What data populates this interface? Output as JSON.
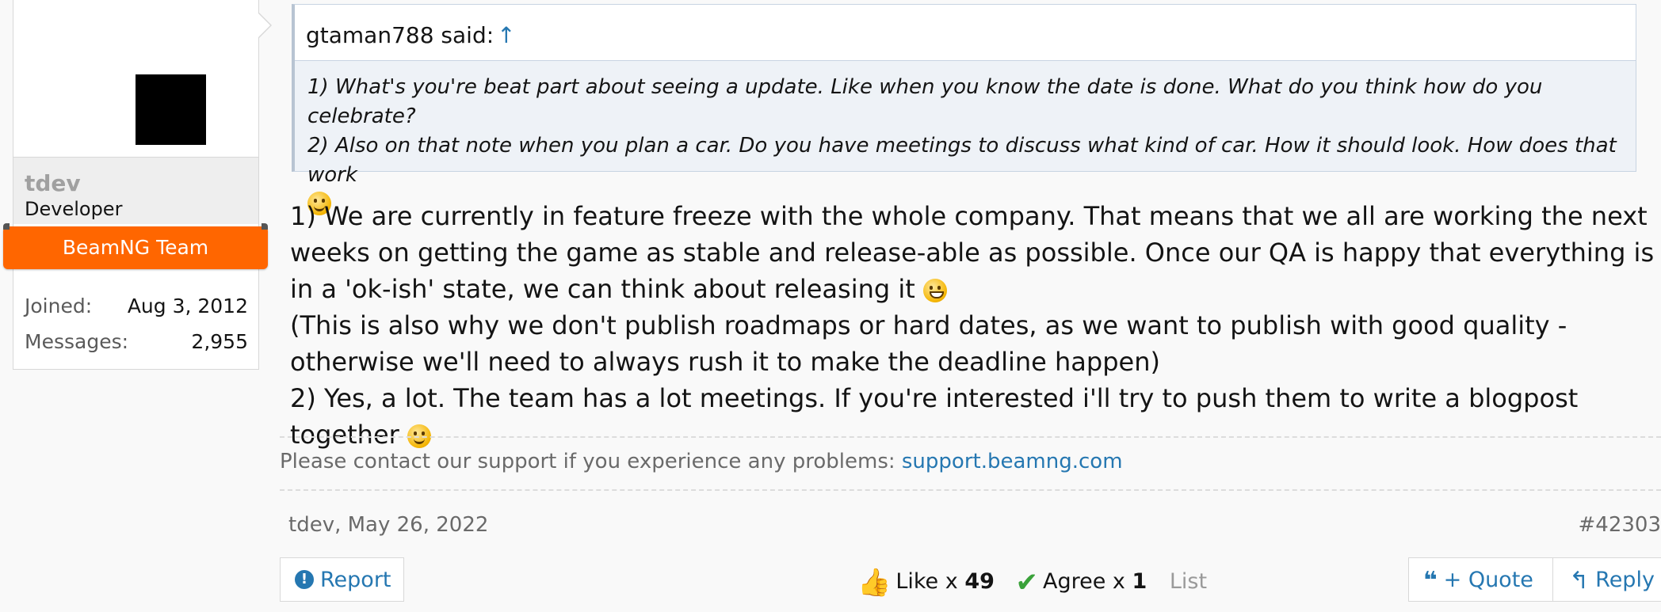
{
  "user": {
    "name": "tdev",
    "title": "Developer",
    "banner": "BeamNG Team",
    "stats": [
      {
        "label": "Joined:",
        "value": "Aug 3, 2012"
      },
      {
        "label": "Messages:",
        "value": "2,955"
      }
    ]
  },
  "quote": {
    "author": "gtaman788 said:",
    "jump_icon": "↑",
    "line1": "1) What's you're beat part about seeing a update. Like when you know the date is done. What do you think how do you celebrate?",
    "line2": "2) Also on that note when you plan a car. Do you have meetings to discuss what kind of car. How it should look. How does that work"
  },
  "message": {
    "p1": "1) We are currently in feature freeze with the whole company. That means that we all are working the next weeks on getting the game as stable and release-able as possible. Once our QA is happy that everything is in a 'ok-ish' state, we can think about releasing it",
    "p2": "(This is also why we don't publish roadmaps or hard dates, as we want to publish with good quality - otherwise we'll need to always rush it to make the deadline happen)",
    "p3": "2) Yes, a lot. The team has a lot meetings. If you're interested i'll try to push them to write a blogpost together"
  },
  "signature": {
    "text": "Please contact our support if you experience any problems:",
    "link": "support.beamng.com"
  },
  "meta": {
    "author_date": "tdev, May 26, 2022",
    "post_number": "#42303"
  },
  "reactions": {
    "like_label": "Like x",
    "like_count": "49",
    "agree_label": "Agree x",
    "agree_count": "1",
    "list_label": "List"
  },
  "actions": {
    "report": "Report",
    "quote": "+ Quote",
    "reply": "Reply"
  },
  "colors": {
    "accent": "#2577b1",
    "team_banner": "#ff6600"
  }
}
